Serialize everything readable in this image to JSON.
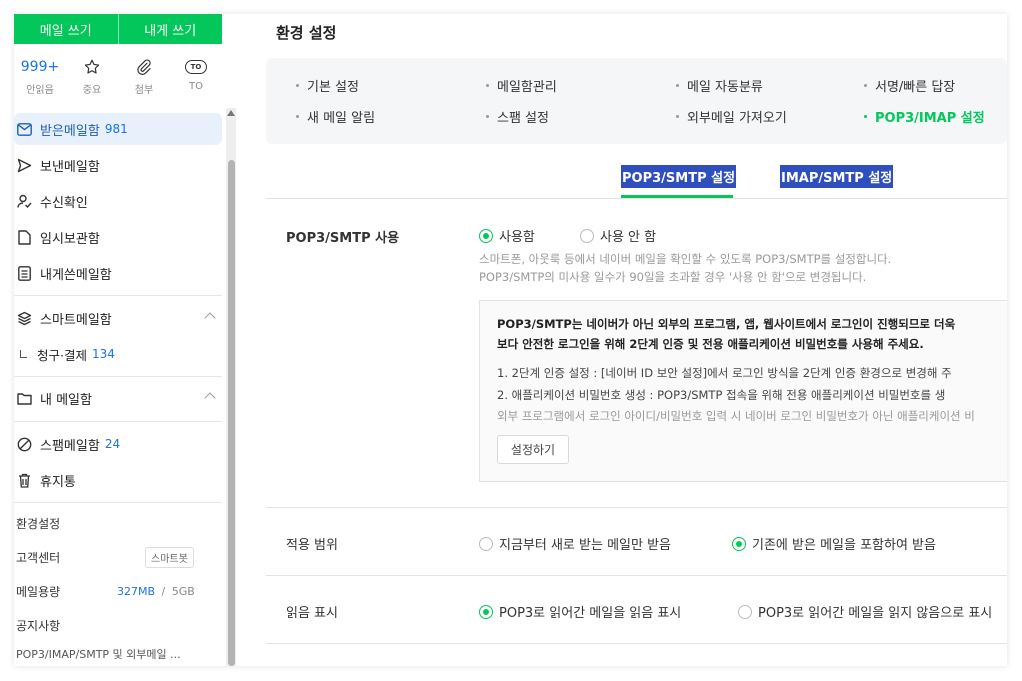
{
  "sidebar": {
    "write_mail": "메일 쓰기",
    "write_to_me": "내게 쓰기",
    "quick": [
      {
        "top": "999+",
        "label": "안읽음"
      },
      {
        "icon": "star-icon",
        "label": "중요"
      },
      {
        "icon": "paperclip-icon",
        "label": "첨부"
      },
      {
        "icon": "to-icon",
        "top": "TO",
        "label": "TO"
      }
    ],
    "inbox": {
      "label": "받은메일함",
      "count": "981"
    },
    "sent": "보낸메일함",
    "read_receipt": "수신확인",
    "drafts": "임시보관함",
    "to_me": "내게쓴메일함",
    "smart": "스마트메일함",
    "billing": {
      "label": "청구·결제",
      "count": "134"
    },
    "my_mailbox": "내 메일함",
    "spam": {
      "label": "스팸메일함",
      "count": "24"
    },
    "trash": "휴지통",
    "settings": "환경설정",
    "support": "고객센터",
    "smartbot": "스마트봇",
    "storage_label": "메일용량",
    "storage_used": "327MB",
    "storage_sep": "/",
    "storage_total": "5GB",
    "notice": "공지사항",
    "notice_item": "POP3/IMAP/SMTP 및 외부메일 ..."
  },
  "main": {
    "title": "환경 설정",
    "menu": [
      "기본 설정",
      "메일함관리",
      "메일 자동분류",
      "서명/빠른 답장",
      "새 메일 알림",
      "스팸 설정",
      "외부메일 가져오기",
      "POP3/IMAP 설정"
    ],
    "tabs": [
      "POP3/SMTP 설정",
      "IMAP/SMTP 설정"
    ],
    "pop3_row": {
      "label": "POP3/SMTP 사용",
      "opt_on": "사용함",
      "opt_off": "사용 안 함",
      "desc1": "스마트폰, 아웃룩 등에서 네이버 메일을 확인할 수 있도록 POP3/SMTP를 설정합니다.",
      "desc2": "POP3/SMTP의 미사용 일수가 90일을 초과할 경우 '사용 안 함'으로 변경됩니다."
    },
    "info": {
      "bold1": "POP3/SMTP는 네이버가 아닌 외부의 프로그램, 앱, 웹사이트에서 로그인이 진행되므로 더욱",
      "bold2": "보다 안전한 로그인을 위해 2단계 인증 및 전용 애플리케이션 비밀번호를 사용해 주세요.",
      "item1": "1. 2단계 인증 설정 : [네이버 ID 보안 설정]에서 로그인 방식을 2단계 인증 환경으로 변경해 주",
      "item2": "2. 애플리케이션 비밀번호 생성 : POP3/SMTP 접속을 위해 전용 애플리케이션 비밀번호를 생",
      "item3": "외부 프로그램에서 로그인 아이디/비밀번호 입력 시 네이버 로그인 비밀번호가 아닌 애플리케이션 비",
      "button": "설정하기"
    },
    "scope_row": {
      "label": "적용 범위",
      "opt_new": "지금부터 새로 받는 메일만 받음",
      "opt_all": "기존에 받은 메일을 포함하여 받음"
    },
    "read_row": {
      "label": "읽음 표시",
      "opt_read": "POP3로 읽어간 메일을 읽음 표시",
      "opt_unread": "POP3로 읽어간 메일을 읽지 않음으로 표시"
    }
  }
}
